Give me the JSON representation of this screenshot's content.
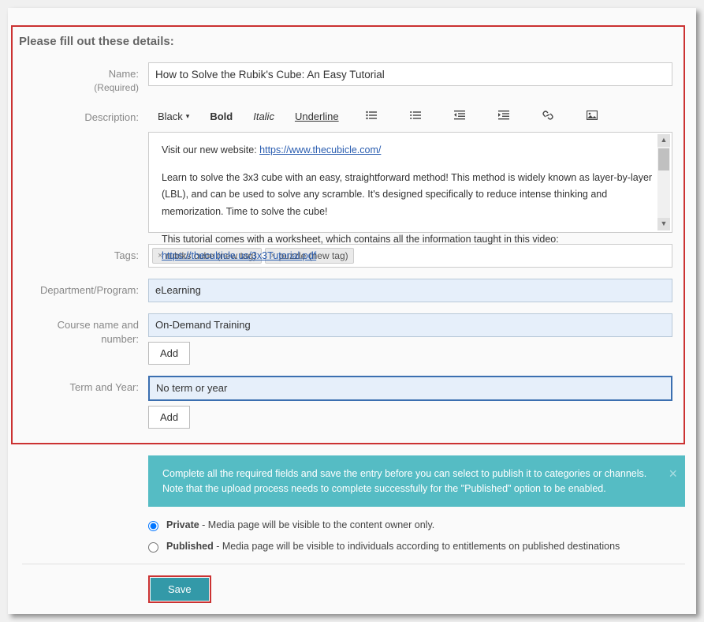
{
  "section_title": "Please fill out these details:",
  "labels": {
    "name": "Name:",
    "required": "(Required)",
    "description": "Description:",
    "tags": "Tags:",
    "department": "Department/Program:",
    "course": "Course name and number:",
    "term": "Term and Year:"
  },
  "values": {
    "name": "How to Solve the Rubik's Cube: An Easy Tutorial",
    "department": "eLearning",
    "course": "On-Demand Training",
    "term": "No term or year"
  },
  "toolbar": {
    "color": "Black",
    "bold": "Bold",
    "italic": "Italic",
    "underline": "Underline"
  },
  "description_text": {
    "intro": "Visit our new website: ",
    "link1": "https://www.thecubicle.com/",
    "para1": "Learn to solve the 3x3 cube with an easy, straightforward method! This method is widely known as layer-by-layer (LBL), and can be used to solve any scramble. It's designed specifically to reduce intense thinking and memorization. Time to solve the cube!",
    "para2a": "This tutorial comes with a worksheet, which contains all the information taught in this video: ",
    "link2": "https://thecubicle.us/3x3Tutorial.pdf"
  },
  "tags": {
    "tag1": "rubiks cube (new tag)",
    "tag2": "puzzle (new tag)"
  },
  "buttons": {
    "add": "Add",
    "save": "Save"
  },
  "info_banner": "Complete all the required fields and save the entry before you can select to publish it to categories or channels. Note that the upload process needs to complete successfully for the \"Published\" option to be enabled.",
  "radio": {
    "private_label": "Private",
    "private_desc": " - Media page will be visible to the content owner only.",
    "published_label": "Published",
    "published_desc": " - Media page will be visible to individuals according to entitlements on published destinations"
  }
}
